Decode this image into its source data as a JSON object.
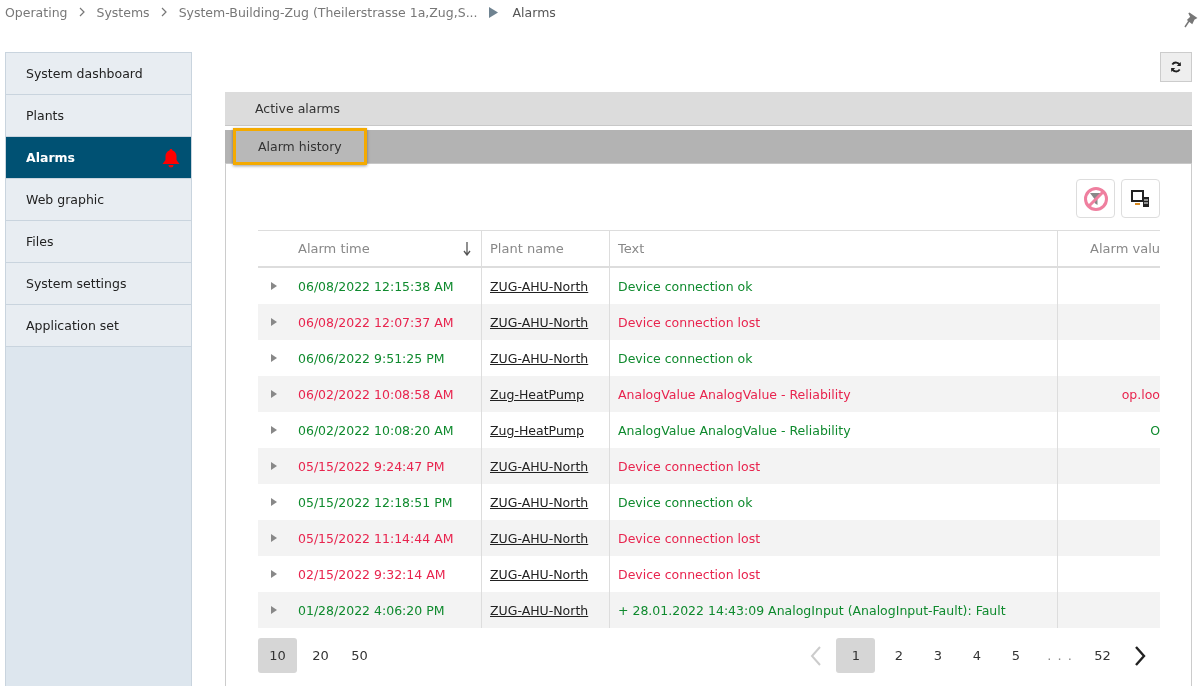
{
  "breadcrumb": [
    {
      "label": "Operating",
      "kind": "link"
    },
    {
      "label": "Systems",
      "kind": "link"
    },
    {
      "label": "System-Building-Zug (Theilerstrasse 1a,Zug,S...",
      "kind": "link"
    },
    {
      "label": "Alarms",
      "kind": "current"
    }
  ],
  "sidebar": {
    "items": [
      {
        "label": "System dashboard",
        "selected": false,
        "alert": false
      },
      {
        "label": "Plants",
        "selected": false,
        "alert": false
      },
      {
        "label": "Alarms",
        "selected": true,
        "alert": true
      },
      {
        "label": "Web graphic",
        "selected": false,
        "alert": false
      },
      {
        "label": "Files",
        "selected": false,
        "alert": false
      },
      {
        "label": "System settings",
        "selected": false,
        "alert": false
      },
      {
        "label": "Application set",
        "selected": false,
        "alert": false
      }
    ]
  },
  "tabs": [
    {
      "label": "Active alarms",
      "selected": false
    },
    {
      "label": "Alarm history",
      "selected": true
    }
  ],
  "table": {
    "columns": [
      "Alarm time",
      "Plant name",
      "Text",
      "Alarm valu"
    ],
    "rows": [
      {
        "time": "06/08/2022 12:15:38 AM",
        "plant": "ZUG-AHU-North",
        "text": "Device connection ok",
        "kind": "normal"
      },
      {
        "time": "06/08/2022 12:07:37 AM",
        "plant": "ZUG-AHU-North",
        "text": "Device connection lost",
        "kind": "alarm"
      },
      {
        "time": "06/06/2022 9:51:25 PM",
        "plant": "ZUG-AHU-North",
        "text": "Device connection ok",
        "kind": "normal"
      },
      {
        "time": "06/02/2022 10:08:58 AM",
        "plant": "Zug-HeatPump",
        "text": "AnalogValue AnalogValue - Reliability",
        "value": "op.loo",
        "kind": "alarm"
      },
      {
        "time": "06/02/2022 10:08:20 AM",
        "plant": "Zug-HeatPump",
        "text": "AnalogValue AnalogValue - Reliability",
        "value": "O",
        "kind": "normal"
      },
      {
        "time": "05/15/2022 9:24:47 PM",
        "plant": "ZUG-AHU-North",
        "text": "Device connection lost",
        "kind": "alarm"
      },
      {
        "time": "05/15/2022 12:18:51 PM",
        "plant": "ZUG-AHU-North",
        "text": "Device connection ok",
        "kind": "normal"
      },
      {
        "time": "05/15/2022 11:14:44 AM",
        "plant": "ZUG-AHU-North",
        "text": "Device connection lost",
        "kind": "alarm"
      },
      {
        "time": "02/15/2022 9:32:14 AM",
        "plant": "ZUG-AHU-North",
        "text": "Device connection lost",
        "kind": "alarm"
      },
      {
        "time": "01/28/2022 4:06:20 PM",
        "plant": "ZUG-AHU-North",
        "text": "+ 28.01.2022 14:43:09 AnalogInput (AnalogInput-Fault): Fault",
        "kind": "normal"
      }
    ]
  },
  "page_sizes": [
    {
      "label": "10",
      "selected": true
    },
    {
      "label": "20",
      "selected": false
    },
    {
      "label": "50",
      "selected": false
    }
  ],
  "pagination": {
    "pages": [
      {
        "label": "1",
        "selected": true
      },
      {
        "label": "2",
        "selected": false
      },
      {
        "label": "3",
        "selected": false
      },
      {
        "label": "4",
        "selected": false
      },
      {
        "label": "5",
        "selected": false
      }
    ],
    "ellipsis": ". . .",
    "last": "52",
    "prev_disabled": true
  }
}
